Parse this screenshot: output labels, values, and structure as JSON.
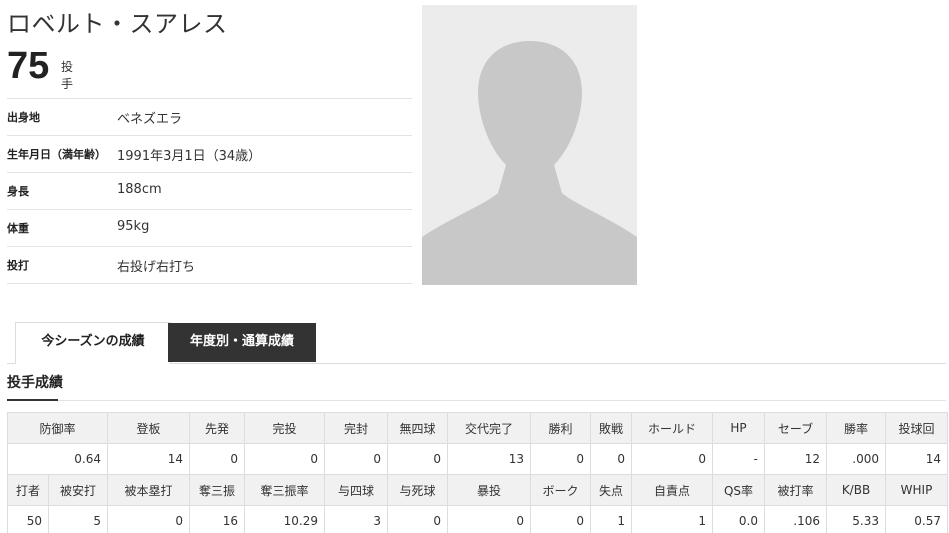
{
  "player": {
    "name": "ロベルト・スアレス",
    "number": "75",
    "position": "投手"
  },
  "profile": [
    {
      "label": "出身地",
      "value": "ベネズエラ"
    },
    {
      "label": "生年月日（満年齢）",
      "value": "1991年3月1日（34歳）"
    },
    {
      "label": "身長",
      "value": "188cm"
    },
    {
      "label": "体重",
      "value": "95kg"
    },
    {
      "label": "投打",
      "value": "右投げ右打ち"
    }
  ],
  "tabs": {
    "current_season": "今シーズンの成績",
    "yearly": "年度別・通算成績"
  },
  "section": {
    "title": "投手成績"
  },
  "stats": {
    "header1": [
      "防御率",
      "登板",
      "先発",
      "完投",
      "完封",
      "無四球",
      "交代完了",
      "勝利",
      "敗戦",
      "ホールド",
      "HP",
      "セーブ",
      "勝率",
      "投球回"
    ],
    "row1": [
      "0.64",
      "14",
      "0",
      "0",
      "0",
      "0",
      "13",
      "0",
      "0",
      "0",
      "-",
      "12",
      ".000",
      "14"
    ],
    "header2": [
      "打者",
      "被安打",
      "被本塁打",
      "奪三振",
      "奪三振率",
      "与四球",
      "与死球",
      "暴投",
      "ボーク",
      "失点",
      "自責点",
      "QS率",
      "被打率",
      "K/BB",
      "WHIP"
    ],
    "row2": [
      "50",
      "5",
      "0",
      "16",
      "10.29",
      "3",
      "0",
      "0",
      "0",
      "1",
      "1",
      "0.0",
      ".106",
      "5.33",
      "0.57"
    ]
  },
  "icons": {
    "photo": "person-silhouette-icon"
  },
  "colors": {
    "tab_active_bg": "#333333",
    "header_bg": "#f1f1f1",
    "photo_bg": "#ececec",
    "silhouette": "#c8c8c8"
  }
}
